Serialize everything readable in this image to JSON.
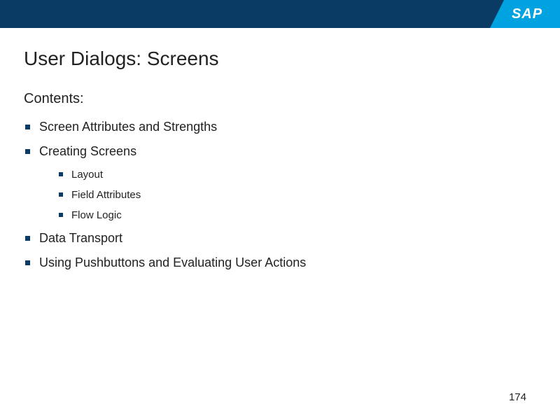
{
  "brand": {
    "logo_text": "SAP"
  },
  "slide": {
    "title": "User Dialogs: Screens",
    "contents_label": "Contents:",
    "items": [
      {
        "label": "Screen Attributes and Strengths"
      },
      {
        "label": "Creating Screens",
        "children": [
          {
            "label": "Layout"
          },
          {
            "label": "Field Attributes"
          },
          {
            "label": "Flow Logic"
          }
        ]
      },
      {
        "label": "Data Transport"
      },
      {
        "label": "Using Pushbuttons and Evaluating User Actions"
      }
    ],
    "page_number": "174"
  },
  "colors": {
    "header": "#0a3b64",
    "logo_bg": "#00a3e0",
    "bullet": "#0a3b64"
  }
}
